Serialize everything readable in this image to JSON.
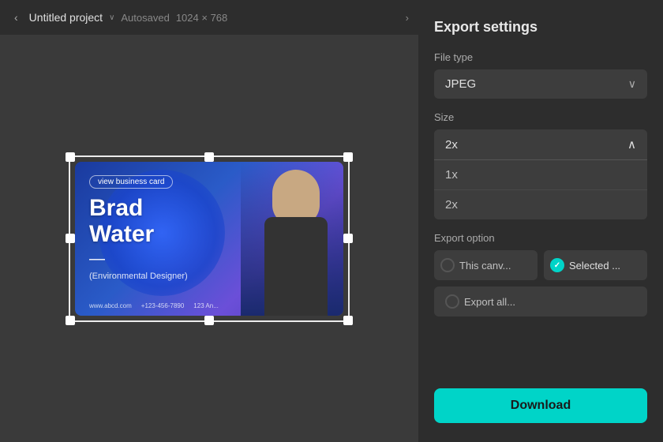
{
  "topbar": {
    "back_icon": "‹",
    "project_title": "Untitled project",
    "chevron": "∨",
    "autosaved": "Autosaved",
    "resolution": "1024 × 768",
    "forward_icon": "›"
  },
  "card": {
    "tag": "view business card",
    "name_line1": "Brad",
    "name_line2": "Water",
    "dash": "—",
    "subtitle": "(Environmental Designer)",
    "website": "www.abcd.com",
    "phone": "+123-456-7890",
    "address": "123 An..."
  },
  "panel": {
    "title": "Export settings",
    "file_type_label": "File type",
    "file_type_value": "JPEG",
    "size_label": "Size",
    "size_selected": "2x",
    "size_chevron": "∧",
    "size_options": [
      "1x",
      "2x"
    ],
    "export_option_label": "Export option",
    "option_this_canvas": "This canv...",
    "option_selected": "Selected ...",
    "option_export_all": "Export all...",
    "download_label": "Download",
    "chevron_down": "∨"
  },
  "colors": {
    "teal": "#00d4c8",
    "panel_bg": "#2d2d2d",
    "input_bg": "#3d3d3d"
  }
}
